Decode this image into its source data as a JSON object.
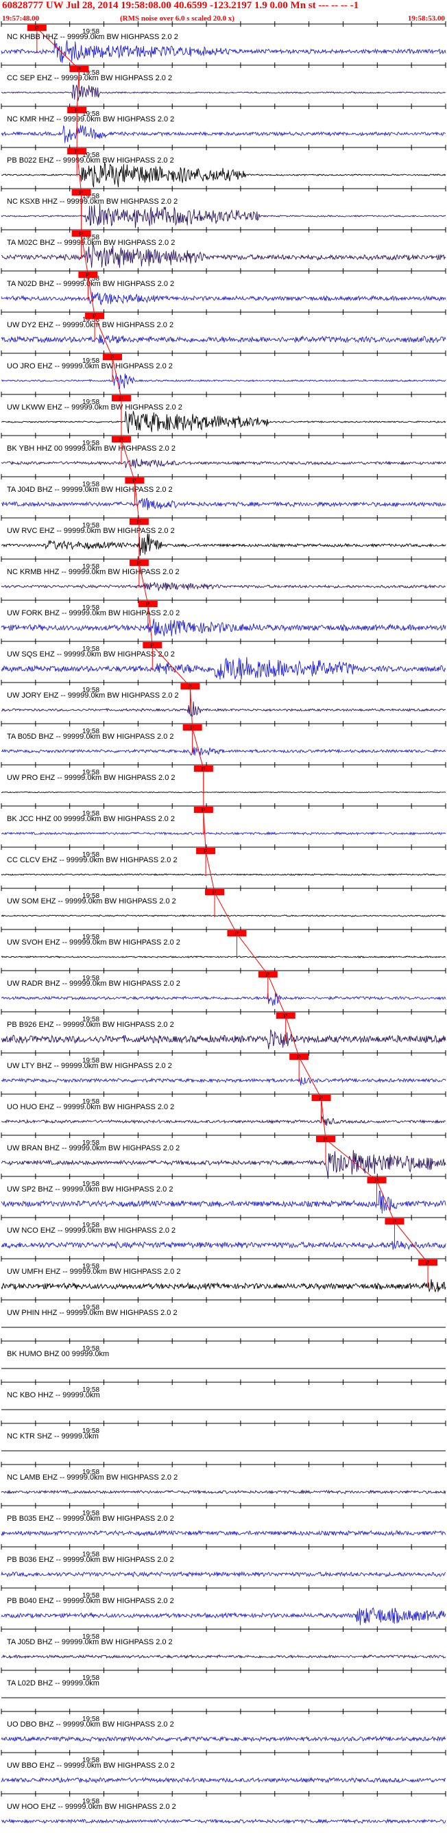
{
  "header": {
    "title": "60828777 UW Jul 28, 2014 19:58:08.00   40.6599 -123.2197  1.9 0.00 Mn st --- -- --  -1",
    "start_time": "19:57:48.00",
    "rms_note": "(RMS noise over 6.0 s scaled 20.0 x)",
    "end_time": "19:58:53.00"
  },
  "colors": {
    "header": "#ff0000",
    "pick_line": "#ff0000",
    "axis": "#000000",
    "blue": "#1f1fd6",
    "black": "#000000",
    "navy": "#2a1460"
  },
  "time_label": "19:58",
  "traces": [
    {
      "label": "NC KHBB HHZ -- 99999.0km BW  HIGHPASS  2.0  2",
      "color": "blue",
      "amp": 0.85,
      "pick": 0.08,
      "pick_label": "P",
      "env": [
        [
          0.12,
          0.2,
          1.0
        ],
        [
          0.2,
          0.52,
          0.55
        ]
      ],
      "base": 0.15
    },
    {
      "label": "CC SEP EHZ -- 99999.0km BW  HIGHPASS  2.0  2",
      "color": "navy",
      "amp": 0.6,
      "pick": 0.175,
      "pick_label": "P",
      "env": [
        [
          0.16,
          0.22,
          0.8
        ]
      ],
      "base": 0.05
    },
    {
      "label": "NC KMR HHZ -- 99999.0km BW  HIGHPASS  2.0  2",
      "color": "blue",
      "amp": 0.6,
      "pick": 0.17,
      "pick_label": "P",
      "env": [
        [
          0.14,
          0.24,
          0.7
        ]
      ],
      "base": 0.12
    },
    {
      "label": "PB B022 EHZ -- 99999.0km BW  HIGHPASS  2.0  2",
      "color": "black",
      "amp": 0.8,
      "pick": 0.17,
      "pick_label": "P",
      "env": [
        [
          0.18,
          0.55,
          0.9
        ]
      ],
      "base": 0.05
    },
    {
      "label": "NC KSXB HHZ -- 99999.0km BW  HIGHPASS  2.0  2",
      "color": "navy",
      "amp": 1.0,
      "pick": 0.18,
      "pick_label": "P",
      "env": [
        [
          0.19,
          0.3,
          1.0
        ],
        [
          0.3,
          0.58,
          0.8
        ]
      ],
      "base": 0.05
    },
    {
      "label": "TA M02C BHZ -- 99999.0km BW  HIGHPASS  2.0  2",
      "color": "navy",
      "amp": 0.9,
      "pick": 0.18,
      "pick_label": "P",
      "env": [
        [
          0.19,
          0.46,
          0.9
        ]
      ],
      "base": 0.18
    },
    {
      "label": "TA N02D BHZ -- 99999.0km BW  HIGHPASS  2.0  2",
      "color": "blue",
      "amp": 0.5,
      "pick": 0.195,
      "pick_label": "P",
      "env": [
        [
          0.2,
          0.35,
          0.5
        ]
      ],
      "base": 0.15
    },
    {
      "label": "UW DY2 EHZ -- 99999.0km BW  HIGHPASS  2.0  2",
      "color": "blue",
      "amp": 0.5,
      "pick": 0.21,
      "pick_label": "P",
      "env": [
        [
          0.22,
          0.3,
          0.4
        ]
      ],
      "base": 0.2
    },
    {
      "label": "UO JRO EHZ -- 99999.0km BW  HIGHPASS  2.0  2",
      "color": "blue",
      "amp": 0.7,
      "pick": 0.25,
      "pick_label": "P",
      "env": [
        [
          0.25,
          0.3,
          0.7
        ]
      ],
      "base": 0.06
    },
    {
      "label": "UW LKWW EHZ -- 99999.0km BW  HIGHPASS  2.0  2",
      "color": "black",
      "amp": 0.8,
      "pick": 0.27,
      "pick_label": "P",
      "env": [
        [
          0.28,
          0.6,
          0.8
        ]
      ],
      "base": 0.05
    },
    {
      "label": "BK YBH HHZ 00 99999.0km BW  HIGHPASS  2.0  2",
      "color": "navy",
      "amp": 0.5,
      "pick": 0.27,
      "pick_label": "P",
      "env": [
        [
          0.28,
          0.4,
          0.4
        ]
      ],
      "base": 0.1
    },
    {
      "label": "TA J04D BHZ -- 99999.0km BW  HIGHPASS  2.0  2",
      "color": "blue",
      "amp": 0.5,
      "pick": 0.3,
      "pick_label": "P",
      "env": [
        [
          0.31,
          0.4,
          0.5
        ]
      ],
      "base": 0.15
    },
    {
      "label": "UW RVC EHZ -- 99999.0km BW  HIGHPASS  2.0  2",
      "color": "black",
      "amp": 0.9,
      "pick": 0.31,
      "pick_label": "P",
      "env": [
        [
          0.31,
          0.36,
          1.0
        ],
        [
          0.1,
          0.31,
          0.35
        ]
      ],
      "base": 0.1
    },
    {
      "label": "NC KRMB HHZ -- 99999.0km BW  HIGHPASS  2.0  2",
      "color": "navy",
      "amp": 0.4,
      "pick": 0.31,
      "pick_label": "P",
      "env": [
        [
          0.32,
          0.5,
          0.35
        ]
      ],
      "base": 0.1
    },
    {
      "label": "UW FORK BHZ -- 99999.0km BW  HIGHPASS  2.0  2",
      "color": "blue",
      "amp": 0.7,
      "pick": 0.33,
      "pick_label": "P",
      "env": [
        [
          0.33,
          0.6,
          0.6
        ]
      ],
      "base": 0.2
    },
    {
      "label": "UW SQS EHZ -- 99999.0km BW  HIGHPASS  2.0  2",
      "color": "blue",
      "amp": 1.0,
      "pick": 0.34,
      "pick_label": "P",
      "env": [
        [
          0.35,
          0.48,
          0.5
        ],
        [
          0.48,
          0.8,
          1.0
        ]
      ],
      "base": 0.2
    },
    {
      "label": "UW JORY EHZ -- 99999.0km BW  HIGHPASS  2.0  2",
      "color": "navy",
      "amp": 0.6,
      "pick": 0.425,
      "pick_label": "P",
      "env": [
        [
          0.42,
          0.45,
          0.7
        ]
      ],
      "base": 0.08
    },
    {
      "label": "TA B05D BHZ -- 99999.0km BW  HIGHPASS  2.0  2",
      "color": "blue",
      "amp": 0.4,
      "pick": 0.43,
      "pick_label": "P",
      "env": [
        [
          0.42,
          0.5,
          0.4
        ]
      ],
      "base": 0.1
    },
    {
      "label": "UW PRO EHZ -- 99999.0km BW  HIGHPASS  2.0  2",
      "color": "black",
      "amp": 0.3,
      "pick": 0.455,
      "pick_label": "P",
      "env": [],
      "base": 0.03
    },
    {
      "label": "BK JCC HHZ 00 99999.0km BW  HIGHPASS  2.0  2",
      "color": "blue",
      "amp": 0.3,
      "pick": 0.455,
      "pick_label": "P",
      "env": [],
      "base": 0.08
    },
    {
      "label": "CC CLCV EHZ -- 99999.0km BW  HIGHPASS  2.0  2",
      "color": "black",
      "amp": 0.3,
      "pick": 0.46,
      "pick_label": "P",
      "env": [],
      "base": 0.05
    },
    {
      "label": "UW SOM EHZ -- 99999.0km BW  HIGHPASS  2.0  2",
      "color": "black",
      "amp": 0.3,
      "pick": 0.48,
      "pick_label": "P",
      "env": [],
      "base": 0.05
    },
    {
      "label": "UW SVOH EHZ -- 99999.0km BW  HIGHPASS  2.0  2",
      "color": "black",
      "amp": 0.3,
      "pick": 0.53,
      "pick_label": "P",
      "env": [],
      "base": 0.05
    },
    {
      "label": "UW RADR BHZ -- 99999.0km BW  HIGHPASS  2.0  2",
      "color": "blue",
      "amp": 0.7,
      "pick": 0.6,
      "pick_label": "P",
      "env": [
        [
          0.6,
          0.63,
          0.9
        ]
      ],
      "base": 0.1
    },
    {
      "label": "PB B926 EHZ -- 99999.0km BW  HIGHPASS  2.0  2",
      "color": "navy",
      "amp": 0.8,
      "pick": 0.64,
      "pick_label": "P",
      "env": [
        [
          0.6,
          0.67,
          0.9
        ]
      ],
      "base": 0.25
    },
    {
      "label": "UW LTY BHZ -- 99999.0km BW  HIGHPASS  2.0  2",
      "color": "blue",
      "amp": 0.5,
      "pick": 0.67,
      "pick_label": "P",
      "env": [
        [
          0.67,
          0.7,
          0.4
        ]
      ],
      "base": 0.12
    },
    {
      "label": "UO HUO EHZ -- 99999.0km BW  HIGHPASS  2.0  2",
      "color": "navy",
      "amp": 0.5,
      "pick": 0.72,
      "pick_label": "P",
      "env": [
        [
          0.72,
          0.76,
          0.4
        ]
      ],
      "base": 0.1
    },
    {
      "label": "UW BRAN BHZ -- 99999.0km BW  HIGHPASS  2.0  2",
      "color": "navy",
      "amp": 1.0,
      "pick": 0.73,
      "pick_label": "P",
      "env": [
        [
          0.73,
          1.0,
          1.0
        ]
      ],
      "base": 0.15
    },
    {
      "label": "UW SP2 BHZ -- 99999.0km BW  HIGHPASS  2.0  2",
      "color": "blue",
      "amp": 0.8,
      "pick": 0.845,
      "pick_label": "P",
      "env": [
        [
          0.85,
          0.89,
          0.9
        ]
      ],
      "base": 0.2
    },
    {
      "label": "UW NCO EHZ -- 99999.0km BW  HIGHPASS  2.0  2",
      "color": "blue",
      "amp": 0.5,
      "pick": 0.885,
      "pick_label": "P",
      "env": [
        [
          0.88,
          0.94,
          0.5
        ]
      ],
      "base": 0.2
    },
    {
      "label": "UW UMFH EHZ -- 99999.0km BW  HIGHPASS  2.0  2",
      "color": "black",
      "amp": 0.5,
      "pick": 0.96,
      "pick_label": "P",
      "env": [
        [
          0.96,
          1.0,
          0.6
        ]
      ],
      "base": 0.2
    },
    {
      "label": "UW PHIN HHZ -- 99999.0km BW  HIGHPASS  2.0  2",
      "color": "black",
      "amp": 0.1,
      "pick": null,
      "pick_label": "",
      "env": [],
      "base": 0.0
    },
    {
      "label": "BK HUMO BHZ 00 99999.0km",
      "color": "black",
      "amp": 0.0,
      "pick": null,
      "pick_label": "",
      "env": [],
      "base": 0.0
    },
    {
      "label": "NC KBO HHZ -- 99999.0km",
      "color": "black",
      "amp": 0.0,
      "pick": null,
      "pick_label": "",
      "env": [],
      "base": 0.0
    },
    {
      "label": "NC KTR SHZ -- 99999.0km",
      "color": "black",
      "amp": 0.0,
      "pick": null,
      "pick_label": "",
      "env": [],
      "base": 0.0
    },
    {
      "label": "NC LAMB EHZ -- 99999.0km BW  HIGHPASS  2.0  2",
      "color": "navy",
      "amp": 0.2,
      "pick": null,
      "pick_label": "",
      "env": [],
      "base": 0.1
    },
    {
      "label": "PB B035 EHZ -- 99999.0km BW  HIGHPASS  2.0  2",
      "color": "blue",
      "amp": 0.3,
      "pick": null,
      "pick_label": "",
      "env": [],
      "base": 0.15
    },
    {
      "label": "PB B036 EHZ -- 99999.0km BW  HIGHPASS  2.0  2",
      "color": "blue",
      "amp": 0.3,
      "pick": null,
      "pick_label": "",
      "env": [],
      "base": 0.15
    },
    {
      "label": "PB B040 EHZ -- 99999.0km BW  HIGHPASS  2.0  2",
      "color": "blue",
      "amp": 0.8,
      "pick": null,
      "pick_label": "",
      "env": [
        [
          0.8,
          1.0,
          0.7
        ]
      ],
      "base": 0.15
    },
    {
      "label": "TA J05D BHZ -- 99999.0km BW  HIGHPASS  2.0  2",
      "color": "navy",
      "amp": 0.2,
      "pick": null,
      "pick_label": "",
      "env": [],
      "base": 0.1
    },
    {
      "label": "TA L02D BHZ -- 99999.0km",
      "color": "black",
      "amp": 0.0,
      "pick": null,
      "pick_label": "",
      "env": [],
      "base": 0.0
    },
    {
      "label": "UO DBO BHZ -- 99999.0km BW  HIGHPASS  2.0  2",
      "color": "blue",
      "amp": 0.3,
      "pick": null,
      "pick_label": "",
      "env": [],
      "base": 0.15
    },
    {
      "label": "UW BBO EHZ -- 99999.0km BW  HIGHPASS  2.0  2",
      "color": "blue",
      "amp": 0.3,
      "pick": null,
      "pick_label": "",
      "env": [],
      "base": 0.15
    },
    {
      "label": "UW HOO EHZ -- 99999.0km BW  HIGHPASS  2.0  2",
      "color": "blue",
      "amp": 0.3,
      "pick": null,
      "pick_label": "",
      "env": [],
      "base": 0.12
    }
  ]
}
